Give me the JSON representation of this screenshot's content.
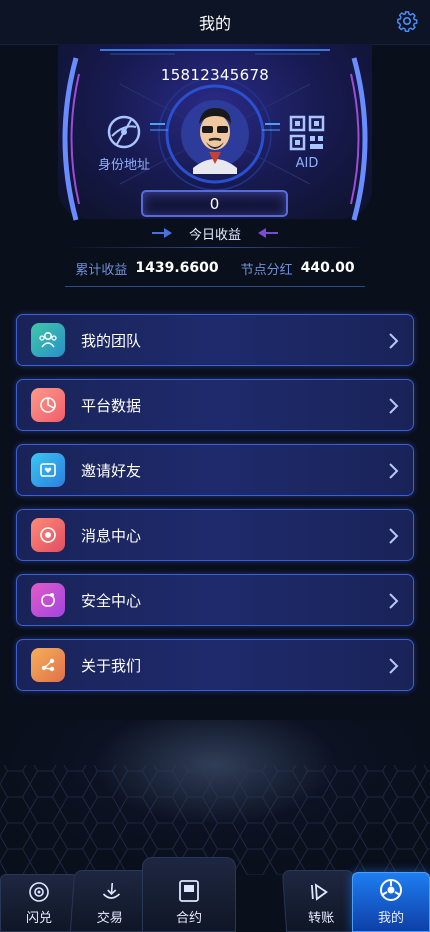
{
  "header": {
    "title": "我的",
    "settings_icon": "gear-icon"
  },
  "hero": {
    "phone": "15812345678",
    "identity_label": "身份地址",
    "aid_label": "AID",
    "today_value": "0",
    "today_label": "今日收益",
    "stats": {
      "cumulative_label": "累计收益",
      "cumulative_value": "1439.6600",
      "node_label": "节点分红",
      "node_value": "440.00"
    }
  },
  "menu": [
    {
      "label": "我的团队",
      "icon": "team-icon",
      "color_a": "#3fc8a8",
      "color_b": "#2a8fc8"
    },
    {
      "label": "平台数据",
      "icon": "pie-chart-icon",
      "color_a": "#ff9a8a",
      "color_b": "#f05d6a"
    },
    {
      "label": "邀请好友",
      "icon": "invite-icon",
      "color_a": "#3cc6f0",
      "color_b": "#2a7fe0"
    },
    {
      "label": "消息中心",
      "icon": "message-icon",
      "color_a": "#ff8a7a",
      "color_b": "#e04e60"
    },
    {
      "label": "安全中心",
      "icon": "shield-icon",
      "color_a": "#e25ac8",
      "color_b": "#a046e0"
    },
    {
      "label": "关于我们",
      "icon": "share-icon",
      "color_a": "#f6b05a",
      "color_b": "#e0704a"
    }
  ],
  "tabs": [
    {
      "label": "闪兑",
      "icon": "target-icon"
    },
    {
      "label": "交易",
      "icon": "trade-icon"
    },
    {
      "label": "合约",
      "icon": "contract-icon"
    },
    {
      "label": "转账",
      "icon": "transfer-icon"
    },
    {
      "label": "我的",
      "icon": "profile-icon"
    }
  ],
  "colors": {
    "accent": "#3a5fd6",
    "active_tab": "#1e7ef0",
    "stat_label": "#6f8fd8"
  }
}
